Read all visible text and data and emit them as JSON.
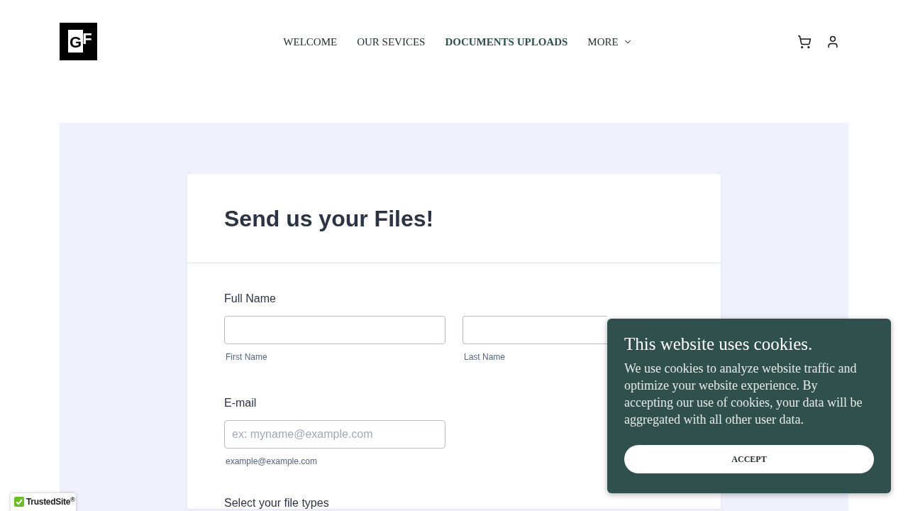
{
  "header": {
    "logo": {
      "text": "GF"
    },
    "nav": [
      {
        "label": "WELCOME",
        "selected": false,
        "kind": "link"
      },
      {
        "label": "OUR SEVICES",
        "selected": false,
        "kind": "link"
      },
      {
        "label": "DOCUMENTS UPLOADS",
        "selected": true,
        "kind": "link"
      },
      {
        "label": "MORE",
        "selected": false,
        "kind": "dropdown"
      }
    ]
  },
  "form": {
    "title": "Send us your Files!",
    "fields": [
      {
        "label": "Full Name",
        "inputs": [
          {
            "sublabel": "First Name"
          },
          {
            "sublabel": "Last Name",
            "covered": true
          }
        ]
      },
      {
        "label": "E-mail",
        "inputs": [
          {
            "placeholder": "ex: myname@example.com",
            "sublabel": "example@example.com"
          }
        ]
      },
      {
        "label": "Select your file types"
      }
    ]
  },
  "cookie_banner": {
    "title": "This website uses cookies.",
    "text": "We use cookies to analyze website traffic and optimize your website experience. By accepting our use of cookies, your data will be aggregated with all other user data.",
    "button": "ACCEPT"
  },
  "trust_badge": {
    "label": "TrustedSite$^{®}$"
  }
}
